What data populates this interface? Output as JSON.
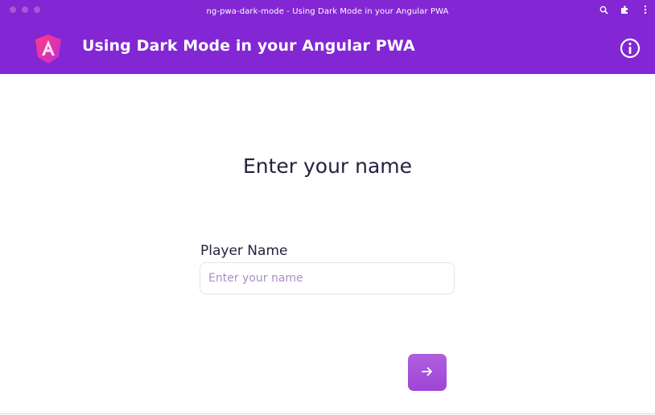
{
  "window": {
    "title": "ng-pwa-dark-mode - Using Dark Mode in your Angular PWA",
    "actions": [
      {
        "icon": "zoom-icon"
      },
      {
        "icon": "extensions-icon"
      },
      {
        "icon": "more-vert-icon"
      }
    ]
  },
  "header": {
    "logo_icon": "angular-logo-icon",
    "title": "Using Dark Mode in your Angular PWA",
    "info_icon": "info-icon"
  },
  "main": {
    "heading": "Enter your name",
    "player_name_label": "Player Name",
    "player_name_placeholder": "Enter your name",
    "player_name_value": "",
    "next_icon": "arrow-right-icon"
  },
  "colors": {
    "brand": "#8326d3",
    "button": "#a653da",
    "text": "#232340",
    "placeholder": "#a98fc4"
  }
}
